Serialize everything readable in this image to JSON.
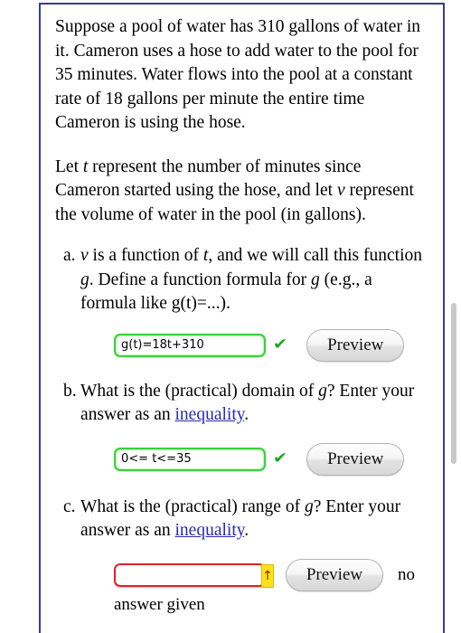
{
  "problem": {
    "paragraph_1": "Suppose a pool of water has 310 gallons of water in it. Cameron uses a hose to add water to the pool for 35 minutes. Water flows into the pool at a constant rate of 18 gallons per minute the entire time Cameron is using the hose.",
    "paragraph_2_part_1": "Let ",
    "paragraph_2_var_t": "t",
    "paragraph_2_part_2": " represent the number of minutes since Cameron started using the hose, and let ",
    "paragraph_2_var_v": "v",
    "paragraph_2_part_3": " represent the volume of water in the pool (in gallons)."
  },
  "parts": [
    {
      "marker": "a.",
      "text_1": "",
      "var_1": "v",
      "text_2": " is a function of ",
      "var_2": "t",
      "text_3": ", and we will call this function ",
      "var_3": "g",
      "text_4": ". Define a function formula for ",
      "var_4": "g",
      "text_5": " (e.g., a formula like g(t)=...).",
      "answer_value": "g(t)=18t+310",
      "answer_placeholder": "",
      "state": "correct",
      "check_icon": "✔",
      "preview_label": "Preview"
    },
    {
      "marker": "b.",
      "text_1": "What is the (practical) domain of ",
      "var_1": "g",
      "text_2": "? Enter your answer as an ",
      "link_label": "inequality",
      "text_3": ".",
      "answer_value": "0<= t<=35",
      "answer_placeholder": "",
      "state": "correct",
      "check_icon": "✔",
      "preview_label": "Preview"
    },
    {
      "marker": "c.",
      "text_1": "What is the (practical) range of ",
      "var_1": "g",
      "text_2": "? Enter your answer as an ",
      "link_label": "inequality",
      "text_3": ".",
      "answer_value": "",
      "answer_placeholder": "",
      "state": "error",
      "caret_icon": "↑",
      "preview_label": "Preview",
      "status_note_line_1": "no",
      "status_note_line_2": "answer given"
    }
  ],
  "colors": {
    "frame_border": "#3b3b8f",
    "input_ok_border": "#3ad13a",
    "input_error_border": "#e02424",
    "check_green": "#18a820",
    "link_blue": "#2a2ab0",
    "caret_yellow": "#ffe11a",
    "scrollbar_thumb": "#c8c8c8"
  }
}
